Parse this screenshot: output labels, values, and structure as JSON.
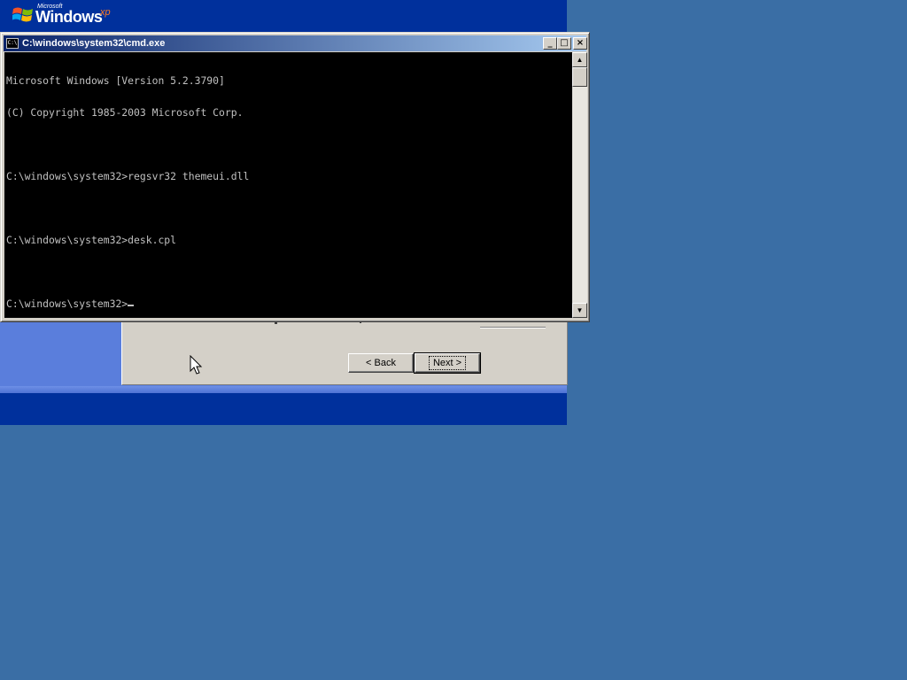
{
  "setup": {
    "logo": {
      "brand_small": "Microsoft",
      "product": "Windows",
      "edition": "xp"
    }
  },
  "wizard": {
    "back_label": "< Back",
    "next_label": "Next >"
  },
  "cmd": {
    "title": "C:\\windows\\system32\\cmd.exe",
    "icon_text": "C:\\",
    "lines": [
      "Microsoft Windows [Version 5.2.3790]",
      "(C) Copyright 1985-2003 Microsoft Corp.",
      "",
      "C:\\windows\\system32>regsvr32 themeui.dll",
      "",
      "C:\\windows\\system32>desk.cpl",
      "",
      "C:\\windows\\system32>"
    ],
    "scrollbar": {
      "up_glyph": "▲",
      "down_glyph": "▼"
    },
    "controls": {
      "minimize": "_",
      "maximize": "□",
      "close": "×"
    }
  },
  "colors": {
    "desktop": "#3a6ea5",
    "setup_band": "#00309c",
    "setup_panel": "#5a7edc",
    "titlebar_start": "#0a246a",
    "titlebar_end": "#a6caf0"
  }
}
